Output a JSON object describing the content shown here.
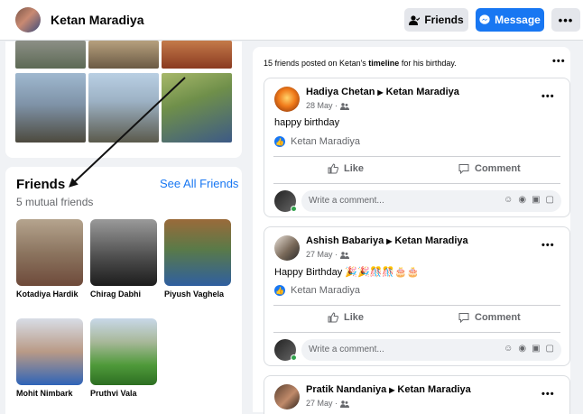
{
  "header": {
    "name": "Ketan Maradiya",
    "friends_btn": "Friends",
    "message_btn": "Message",
    "more_btn": "•••"
  },
  "friends": {
    "title": "Friends",
    "see_all": "See All Friends",
    "mutual": "5 mutual friends",
    "list": [
      {
        "name": "Kotadiya Hardik"
      },
      {
        "name": "Chirag Dabhi"
      },
      {
        "name": "Piyush Vaghela"
      },
      {
        "name": "Mohit Nimbark"
      },
      {
        "name": "Pruthvi Vala"
      }
    ]
  },
  "timeline": {
    "summary_pre": "15 friends posted on Ketan's ",
    "summary_link": "timeline",
    "summary_post": " for his birthday.",
    "dots": "•••"
  },
  "posts": [
    {
      "author": "Hadiya Chetan",
      "target": "Ketan Maradiya",
      "date": "28 May ·",
      "text": "happy birthday",
      "tag": "Ketan Maradiya",
      "like": "Like",
      "comment": "Comment",
      "placeholder": "Write a comment..."
    },
    {
      "author": "Ashish Babariya",
      "target": "Ketan Maradiya",
      "date": "27 May ·",
      "text": "Happy Birthday 🎉🎉🎊🎊🎂🎂",
      "tag": "Ketan Maradiya",
      "like": "Like",
      "comment": "Comment",
      "placeholder": "Write a comment..."
    },
    {
      "author": "Pratik Nandaniya",
      "target": "Ketan Maradiya",
      "date": "27 May ·"
    }
  ],
  "colors": {
    "accent": "#1877f2",
    "secondary_text": "#65676b",
    "background": "#f0f2f5"
  }
}
